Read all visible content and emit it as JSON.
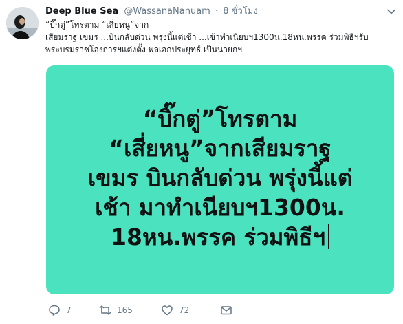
{
  "tweet": {
    "author": {
      "display_name": "Deep Blue Sea",
      "handle": "@WassanaNanuam",
      "dot": "·",
      "time": "8 ชั่วโมง"
    },
    "text_lines": [
      "“บิ๊กตู่”โทรตาม “เสี่ยหนู”จาก",
      "เสียมราฐ เขมร ...บินกลับด่วน พรุ่งนี้แต่เช้า ...เข้าทำเนียบฯ1300น.18หน.พรรค ร่วมพิธีฯรับ",
      "พระบรมราชโองการฯแต่งตั้ง พลเอกประยุทธ์ เป็นนายกฯ"
    ],
    "media": {
      "background_color": "#4be2c0",
      "lines": [
        "“บิ๊กตู่”โทรตาม",
        "“เสี่ยหนู”จากเสียมราฐ",
        "เขมร บินกลับด่วน พรุ่งนี้แต่",
        "เช้า มาทำเนียบฯ1300น.",
        "18หน.พรรค ร่วมพิธีฯ"
      ]
    },
    "actions": {
      "reply": {
        "icon": "reply-icon",
        "count": "7"
      },
      "retweet": {
        "icon": "retweet-icon",
        "count": "165"
      },
      "like": {
        "icon": "heart-icon",
        "count": "72"
      },
      "dm": {
        "icon": "envelope-icon"
      }
    },
    "colors": {
      "secondary_text": "#657786",
      "primary_text": "#14171a"
    }
  }
}
